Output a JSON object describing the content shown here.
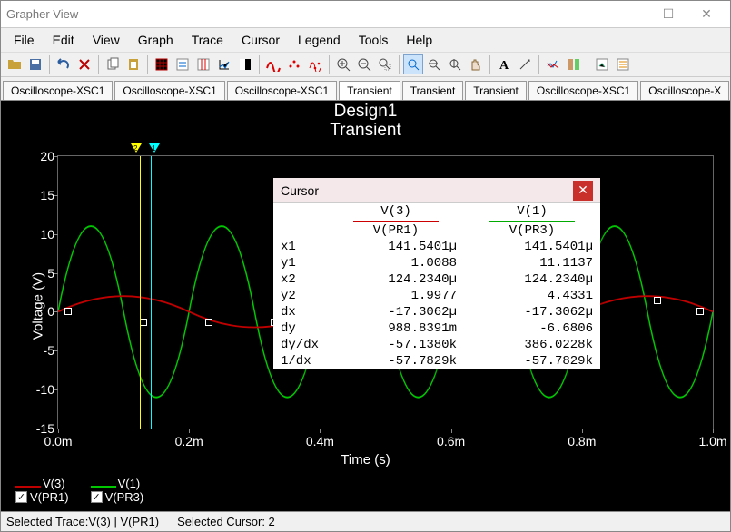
{
  "window": {
    "title": "Grapher View"
  },
  "menu": [
    "File",
    "Edit",
    "View",
    "Graph",
    "Trace",
    "Cursor",
    "Legend",
    "Tools",
    "Help"
  ],
  "tabs": [
    {
      "label": "Oscilloscope-XSC1",
      "active": false
    },
    {
      "label": "Oscilloscope-XSC1",
      "active": false
    },
    {
      "label": "Oscilloscope-XSC1",
      "active": false
    },
    {
      "label": "Transient",
      "active": true
    },
    {
      "label": "Transient",
      "active": false
    },
    {
      "label": "Transient",
      "active": false
    },
    {
      "label": "Oscilloscope-XSC1",
      "active": false
    },
    {
      "label": "Oscilloscope-X",
      "active": false
    }
  ],
  "chart": {
    "title1": "Design1",
    "title2": "Transient",
    "xlabel": "Time (s)",
    "ylabel": "Voltage (V)",
    "xticks": [
      "0.0m",
      "0.2m",
      "0.4m",
      "0.6m",
      "0.8m",
      "1.0m"
    ],
    "yticks": [
      "20",
      "15",
      "10",
      "5",
      "0",
      "-5",
      "-10",
      "-15"
    ]
  },
  "legend": [
    {
      "name": "V(3)",
      "sub": "V(PR1)",
      "color": "#c00000"
    },
    {
      "name": "V(1)",
      "sub": "V(PR3)",
      "color": "#00c800"
    }
  ],
  "cursor": {
    "title": "Cursor",
    "cols": [
      {
        "h1": "V(3)",
        "h2": "V(PR1)"
      },
      {
        "h1": "V(1)",
        "h2": "V(PR3)"
      }
    ],
    "rows": [
      {
        "k": "x1",
        "a": "141.5401µ",
        "b": "141.5401µ"
      },
      {
        "k": "y1",
        "a": "1.0088",
        "b": "11.1137"
      },
      {
        "k": "x2",
        "a": "124.2340µ",
        "b": "124.2340µ"
      },
      {
        "k": "y2",
        "a": "1.9977",
        "b": "4.4331"
      },
      {
        "k": "dx",
        "a": "-17.3062µ",
        "b": "-17.3062µ"
      },
      {
        "k": "dy",
        "a": "988.8391m",
        "b": "-6.6806"
      },
      {
        "k": "dy/dx",
        "a": "-57.1380k",
        "b": "386.0228k"
      },
      {
        "k": "1/dx",
        "a": "-57.7829k",
        "b": "-57.7829k"
      }
    ]
  },
  "status": {
    "a": "Selected Trace:V(3) | V(PR1)",
    "b": "Selected Cursor: 2"
  },
  "chart_data": {
    "type": "line",
    "xlabel": "Time (s)",
    "ylabel": "Voltage (V)",
    "xlim": [
      0.0,
      0.001
    ],
    "ylim": [
      -15,
      20
    ],
    "series": [
      {
        "name": "V(3) V(PR1)",
        "color": "#c00000",
        "note": "sine, amplitude≈2, period≈0.2ms"
      },
      {
        "name": "V(1) V(PR3)",
        "color": "#00c800",
        "note": "sine/quasi-triangle, amplitude≈11, period≈0.1ms"
      }
    ],
    "cursors": [
      {
        "id": 1,
        "x": 0.0001415401,
        "color": "#0ff"
      },
      {
        "id": 2,
        "x": 0.000124234,
        "color": "#ff0"
      }
    ]
  }
}
